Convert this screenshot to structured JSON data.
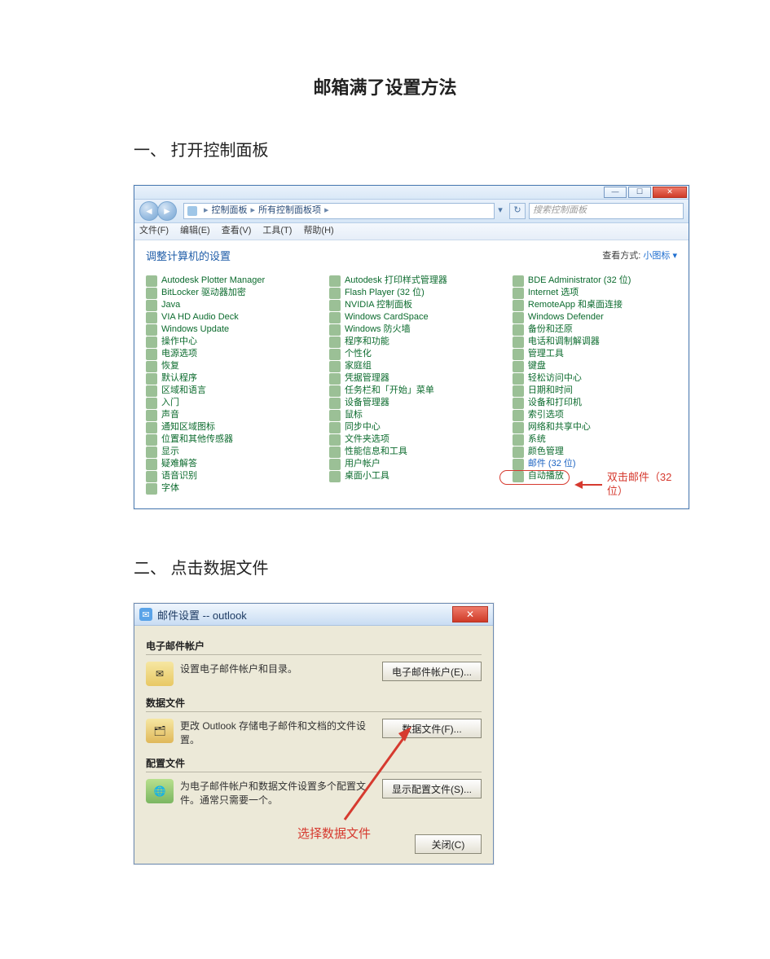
{
  "doc": {
    "title": "邮箱满了设置方法",
    "section1": "一、 打开控制面板",
    "section2": "二、 点击数据文件"
  },
  "cp": {
    "breadcrumb1": "控制面板",
    "breadcrumb2": "所有控制面板项",
    "search_placeholder": "搜索控制面板",
    "menu": {
      "file": "文件(F)",
      "edit": "编辑(E)",
      "view": "查看(V)",
      "tools": "工具(T)",
      "help": "帮助(H)"
    },
    "heading": "调整计算机的设置",
    "view_label": "查看方式:",
    "view_value": "小图标 ▾",
    "col1": [
      "Autodesk Plotter Manager",
      "BitLocker 驱动器加密",
      "Java",
      "VIA HD Audio Deck",
      "Windows Update",
      "操作中心",
      "电源选项",
      "恢复",
      "默认程序",
      "区域和语言",
      "入门",
      "声音",
      "通知区域图标",
      "位置和其他传感器",
      "显示",
      "疑难解答",
      "语音识别",
      "字体"
    ],
    "col2": [
      "Autodesk 打印样式管理器",
      "Flash Player (32 位)",
      "NVIDIA 控制面板",
      "Windows CardSpace",
      "Windows 防火墙",
      "程序和功能",
      "个性化",
      "家庭组",
      "凭据管理器",
      "任务栏和「开始」菜单",
      "设备管理器",
      "鼠标",
      "同步中心",
      "文件夹选项",
      "性能信息和工具",
      "用户帐户",
      "桌面小工具"
    ],
    "col3": [
      "BDE Administrator (32 位)",
      "Internet 选项",
      "RemoteApp 和桌面连接",
      "Windows Defender",
      "备份和还原",
      "电话和调制解调器",
      "管理工具",
      "键盘",
      "轻松访问中心",
      "日期和时间",
      "设备和打印机",
      "索引选项",
      "网络和共享中心",
      "系统",
      "颜色管理",
      "邮件 (32 位)",
      "自动播放"
    ],
    "annotation": "双击邮件（32位）"
  },
  "dlg": {
    "title": "邮件设置 -- outlook",
    "grp_email_title": "电子邮件帐户",
    "grp_email_text": "设置电子邮件帐户和目录。",
    "btn_email": "电子邮件帐户(E)...",
    "grp_data_title": "数据文件",
    "grp_data_text": "更改 Outlook 存储电子邮件和文档的文件设置。",
    "btn_data": "数据文件(F)...",
    "grp_profile_title": "配置文件",
    "grp_profile_text": "为电子邮件帐户和数据文件设置多个配置文件。通常只需要一个。",
    "btn_profile": "显示配置文件(S)...",
    "btn_close": "关闭(C)",
    "annotation": "选择数据文件"
  }
}
